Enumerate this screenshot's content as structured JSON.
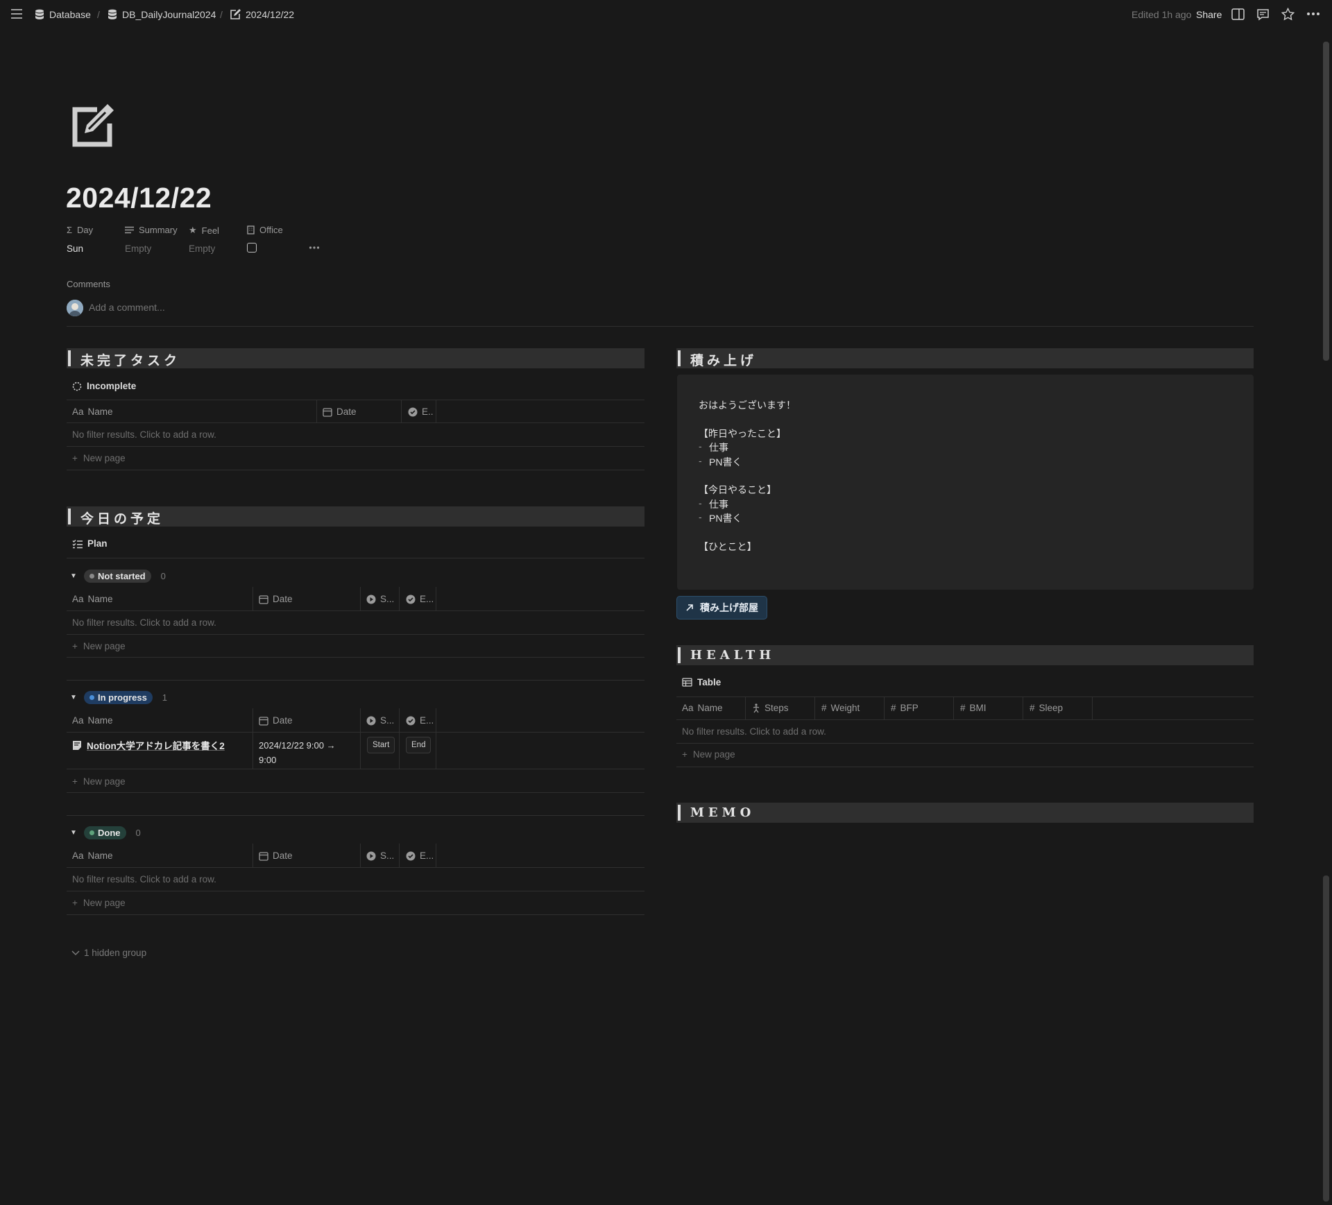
{
  "topbar": {
    "breadcrumb": [
      {
        "label": "Database",
        "icon": "database-icon"
      },
      {
        "label": "DB_DailyJournal2024",
        "icon": "database-icon"
      },
      {
        "label": "2024/12/22",
        "icon": "edit-page-icon"
      }
    ],
    "edited": "Edited 1h ago",
    "share": "Share"
  },
  "page": {
    "title": "2024/12/22",
    "properties": [
      {
        "name": "Day",
        "value": "Sun"
      },
      {
        "name": "Summary",
        "value": "Empty"
      },
      {
        "name": "Feel",
        "value": "Empty"
      },
      {
        "name": "Office",
        "value": ""
      }
    ],
    "comments_label": "Comments",
    "comment_placeholder": "Add a comment..."
  },
  "incomplete": {
    "header": "未完了タスク",
    "view": "Incomplete",
    "columns": [
      "Aa",
      "Name",
      "Date",
      "E.."
    ],
    "empty": "No filter results. Click to add a row.",
    "new_page": "New page"
  },
  "plan": {
    "header": "今日の予定",
    "view": "Plan",
    "columns": {
      "aa": "Aa",
      "name": "Name",
      "date": "Date",
      "start": "S...",
      "end": "E..."
    },
    "groups": [
      {
        "label": "Not started",
        "count": "0",
        "color": "#8a8a8a",
        "bg": "#373737"
      },
      {
        "label": "In progress",
        "count": "1",
        "color": "#4a8fd9",
        "bg": "#1f3c61"
      },
      {
        "label": "Done",
        "count": "0",
        "color": "#5fa37c",
        "bg": "#24403a"
      }
    ],
    "row": {
      "name": "Notion大学アドカレ記事を書く2",
      "date_line1": "2024/12/22 9:00 →",
      "date_line2": "9:00",
      "start_btn": "Start",
      "end_btn": "End"
    },
    "empty": "No filter results. Click to add a row.",
    "new_page": "New page",
    "hidden_group": "1 hidden group"
  },
  "tsumiage": {
    "header": "積み上げ",
    "lines": [
      "おはようございます！",
      "【昨日やったこと】",
      "-",
      "仕事",
      "-",
      "PN書く",
      "【今日やること】",
      "-",
      "仕事",
      "-",
      "PN書く",
      "【ひとこと】"
    ],
    "link_button": "積み上げ部屋"
  },
  "health": {
    "header": "HEALTH",
    "view": "Table",
    "columns": [
      "Aa",
      "Name",
      "Steps",
      "Weight",
      "BFP",
      "BMI",
      "Sleep"
    ],
    "empty": "No filter results. Click to add a row.",
    "new_page": "New page"
  },
  "memo": {
    "header": "MEMO"
  },
  "colors": {
    "background": "#191919",
    "section_bar": "#2f2f2f",
    "link_button": "#1f3447"
  }
}
